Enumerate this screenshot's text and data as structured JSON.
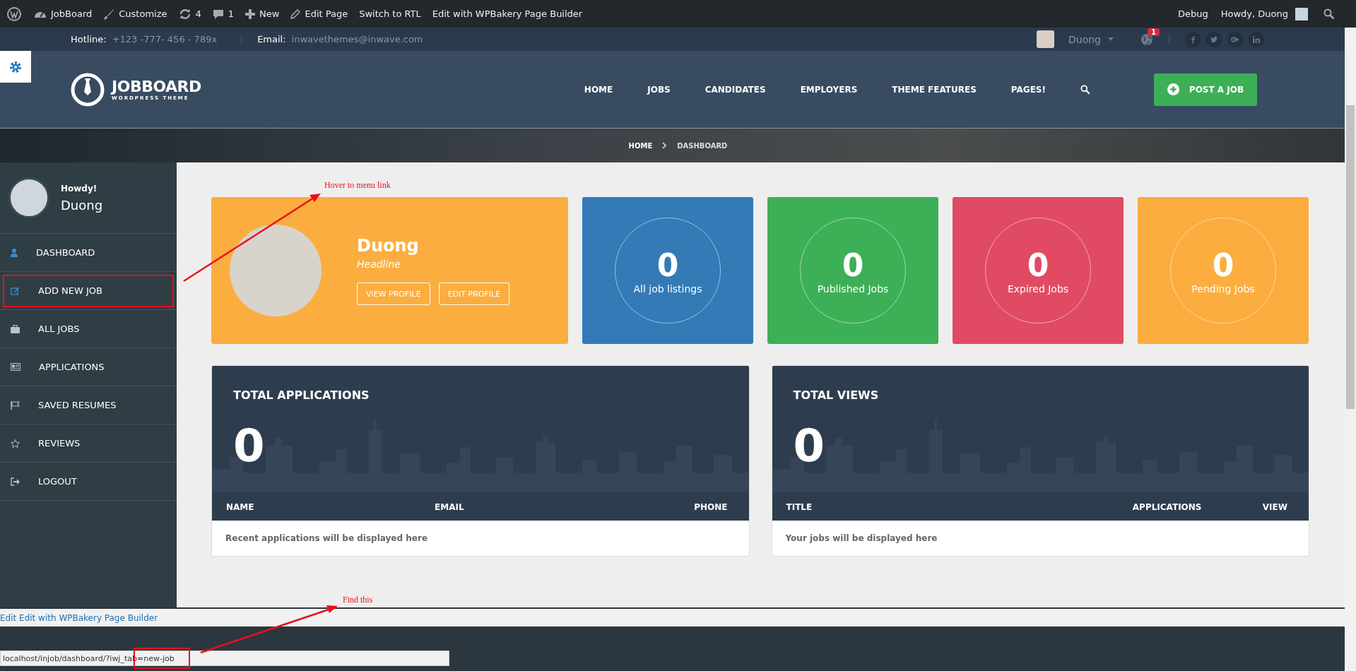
{
  "admin_bar": {
    "items": [
      {
        "kind": "wp"
      },
      {
        "kind": "dashboard",
        "label": "JobBoard"
      },
      {
        "kind": "brush",
        "label": "Customize"
      },
      {
        "kind": "refresh",
        "label": "4"
      },
      {
        "kind": "comment",
        "label": "1"
      },
      {
        "kind": "plus",
        "label": "New"
      },
      {
        "kind": "pencil",
        "label": "Edit Page"
      },
      {
        "kind": "text",
        "label": "Switch to RTL"
      },
      {
        "kind": "text",
        "label": "Edit with WPBakery Page Builder"
      }
    ],
    "right": {
      "debug": "Debug",
      "howdy": "Howdy, Duong"
    }
  },
  "top_bar": {
    "hotline_label": "Hotline:",
    "hotline": "+123 -777- 456 - 789x",
    "email_label": "Email:",
    "email": "inwavethemes@inwave.com",
    "user": "Duong",
    "notification_count": "1"
  },
  "header": {
    "logo_title": "JOBBOARD",
    "logo_subtitle": "WORDPRESS THEME",
    "nav": [
      "HOME",
      "JOBS",
      "CANDIDATES",
      "EMPLOYERS",
      "THEME FEATURES",
      "PAGES!"
    ],
    "post_button": "POST A JOB"
  },
  "breadcrumb": [
    "HOME",
    "DASHBOARD"
  ],
  "sidebar": {
    "greeting": "Howdy!",
    "name": "Duong",
    "items": [
      {
        "kind": "user",
        "label": "DASHBOARD",
        "annotated": false
      },
      {
        "kind": "edit",
        "label": "ADD NEW JOB",
        "annotated": true
      },
      {
        "kind": "briefcase",
        "label": "ALL JOBS",
        "annotated": false
      },
      {
        "kind": "card",
        "label": "APPLICATIONS",
        "annotated": false
      },
      {
        "kind": "flag",
        "label": "SAVED RESUMES",
        "annotated": false
      },
      {
        "kind": "star",
        "label": "REVIEWS",
        "annotated": false
      },
      {
        "kind": "logout",
        "label": "LOGOUT",
        "annotated": false
      }
    ]
  },
  "profile": {
    "name": "Duong",
    "headline": "Headline",
    "buttons": [
      "VIEW PROFILE",
      "EDIT PROFILE"
    ]
  },
  "stats": [
    {
      "value": "0",
      "label": "All job listings",
      "color": "#337ab7"
    },
    {
      "value": "0",
      "label": "Published Jobs",
      "color": "#3daf57"
    },
    {
      "value": "0",
      "label": "Expired Jobs",
      "color": "#e04b63"
    },
    {
      "value": "0",
      "label": "Pending Jobs",
      "color": "#fbae3f"
    }
  ],
  "panels": [
    {
      "title": "TOTAL APPLICATIONS",
      "value": "0",
      "columns": [
        "NAME",
        "EMAIL",
        "PHONE"
      ],
      "empty": "Recent applications will be displayed here"
    },
    {
      "title": "TOTAL VIEWS",
      "value": "0",
      "columns": [
        "TITLE",
        "APPLICATIONS",
        "VIEW"
      ],
      "empty": "Your jobs will be displayed here"
    }
  ],
  "edit_link": "Edit Edit with WPBakery Page Builder",
  "status_url": "localhost/injob/dashboard/?iwj_tab=new-job",
  "annotations": [
    "Hover to menu link",
    "Find this"
  ]
}
